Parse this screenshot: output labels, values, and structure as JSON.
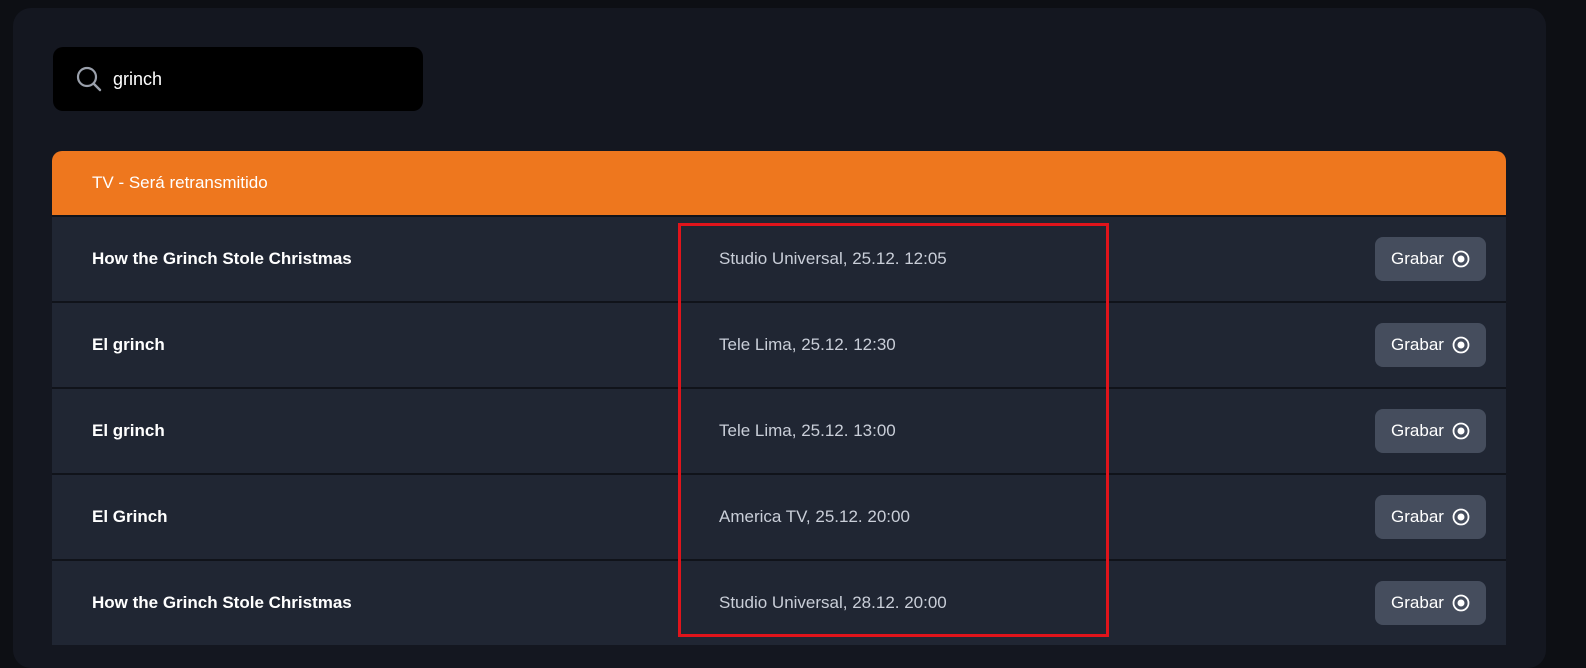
{
  "search": {
    "value": "grinch",
    "icon": "search-icon"
  },
  "section": {
    "header": "TV - Será retransmitido",
    "accent_color": "#ee771e"
  },
  "rows": [
    {
      "title": "How the Grinch Stole Christmas",
      "schedule": "Studio Universal, 25.12. 12:05",
      "action": "Grabar"
    },
    {
      "title": "El grinch",
      "schedule": "Tele Lima, 25.12. 12:30",
      "action": "Grabar"
    },
    {
      "title": "El grinch",
      "schedule": "Tele Lima, 25.12. 13:00",
      "action": "Grabar"
    },
    {
      "title": "El Grinch",
      "schedule": "America TV, 25.12. 20:00",
      "action": "Grabar"
    },
    {
      "title": "How the Grinch Stole Christmas",
      "schedule": "Studio Universal, 28.12. 20:00",
      "action": "Grabar"
    }
  ],
  "highlight_color": "#e0141b"
}
